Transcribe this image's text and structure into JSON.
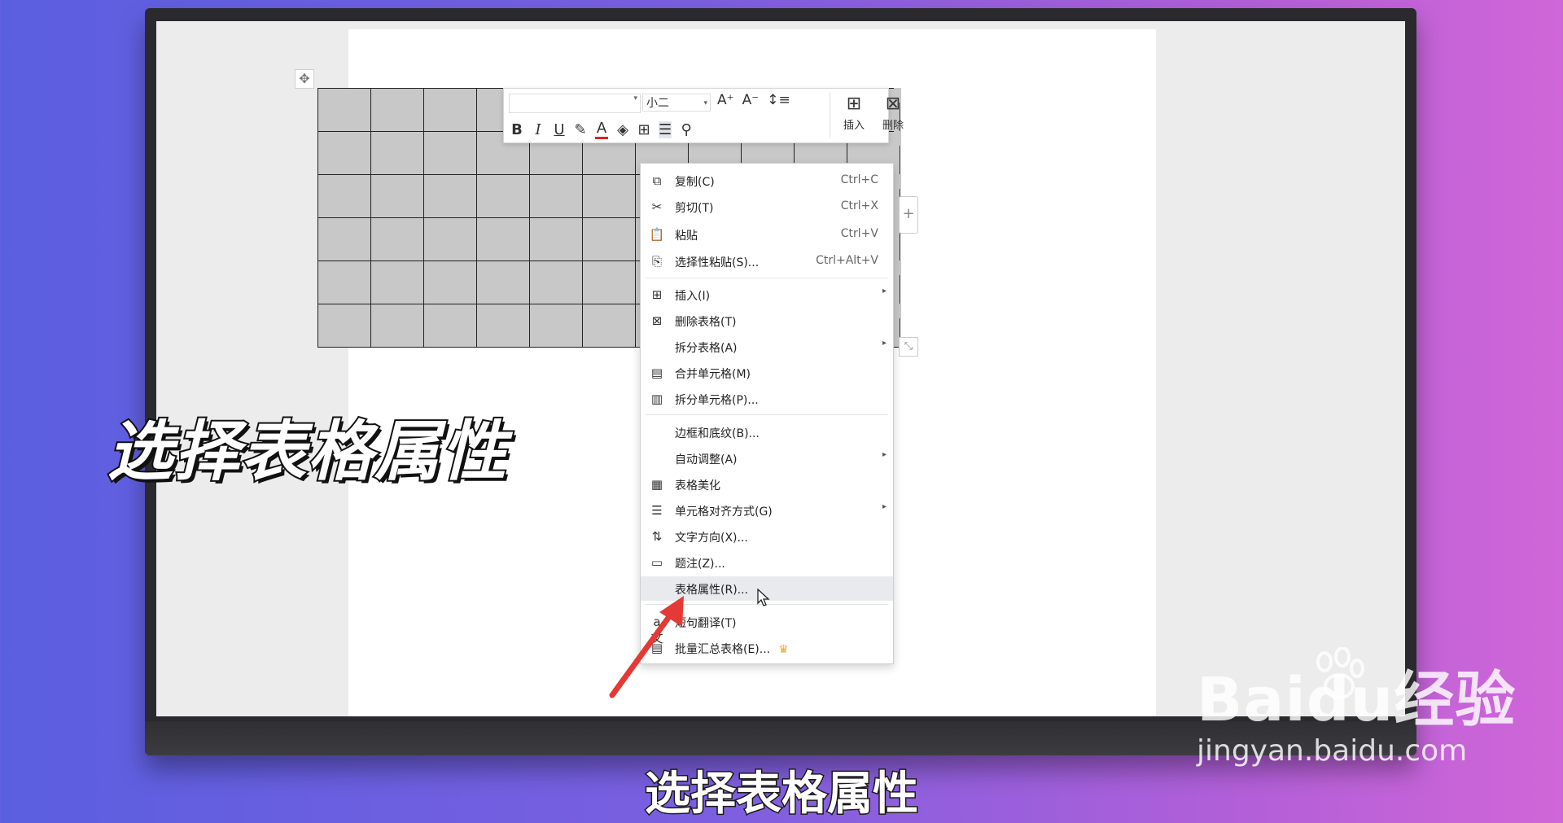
{
  "toolbar": {
    "font_size": "小二",
    "insert_label": "插入",
    "delete_label": "删除"
  },
  "context_menu": {
    "items": [
      {
        "label": "复制(C)",
        "shortcut": "Ctrl+C"
      },
      {
        "label": "剪切(T)",
        "shortcut": "Ctrl+X"
      },
      {
        "label": "粘贴",
        "shortcut": "Ctrl+V"
      },
      {
        "label": "选择性粘贴(S)...",
        "shortcut": "Ctrl+Alt+V"
      },
      {
        "label": "插入(I)"
      },
      {
        "label": "删除表格(T)"
      },
      {
        "label": "拆分表格(A)"
      },
      {
        "label": "合并单元格(M)"
      },
      {
        "label": "拆分单元格(P)..."
      },
      {
        "label": "边框和底纹(B)..."
      },
      {
        "label": "自动调整(A)"
      },
      {
        "label": "表格美化"
      },
      {
        "label": "单元格对齐方式(G)"
      },
      {
        "label": "文字方向(X)..."
      },
      {
        "label": "题注(Z)..."
      },
      {
        "label": "表格属性(R)..."
      },
      {
        "label": "短句翻译(T)"
      },
      {
        "label": "批量汇总表格(E)..."
      }
    ]
  },
  "overlay": {
    "caption": "选择表格属性",
    "subtitle": "选择表格属性"
  },
  "watermark": {
    "brand": "Baidu经验",
    "url": "jingyan.baidu.com"
  },
  "colors": {
    "background_left": "#5a5fe0",
    "background_right": "#d066d8",
    "cell_fill": "#c8c8c8",
    "arrow": "#e53935",
    "menu_highlight": "#e8eaed"
  }
}
